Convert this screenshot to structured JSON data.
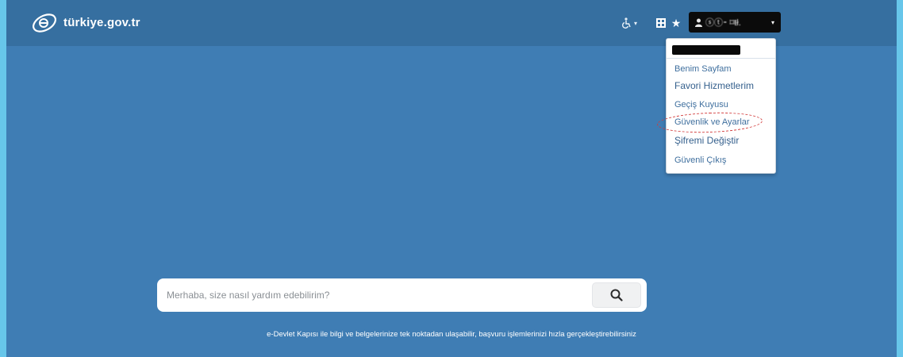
{
  "header": {
    "logo_text": "türkiye.gov.tr",
    "accessibility_chevron": "▾",
    "favorite_star": "★",
    "user_button": {
      "name": "ⓢⓣ⁃ ⌑ŧł.",
      "chevron": "▾"
    }
  },
  "user_menu": {
    "items": [
      {
        "label": "Benim Sayfam",
        "style": "normal"
      },
      {
        "label": "Favori Hizmetlerim",
        "style": "big"
      },
      {
        "label": "Geçiş Kuyusu",
        "style": "normal"
      },
      {
        "label": "Güvenlik ve Ayarlar",
        "style": "normal",
        "highlighted": true
      },
      {
        "label": "Şifremi Değiştir",
        "style": "big"
      },
      {
        "label": "Güvenli Çıkış",
        "style": "normal"
      }
    ],
    "highlight_color": "#d23a3a"
  },
  "search": {
    "placeholder": "Merhaba, size nasıl yardım edebilirim?"
  },
  "footer": {
    "text": "e-Devlet Kapısı ile bilgi ve belgelerinize tek noktadan ulaşabilir, başvuru işlemlerinizi hızla gerçekleştirebilirsiniz"
  },
  "colors": {
    "background": "#3f7db4",
    "topbar": "#366fa0",
    "outer_frame": "#67c6ea",
    "menu_link": "#3f6f9e"
  }
}
